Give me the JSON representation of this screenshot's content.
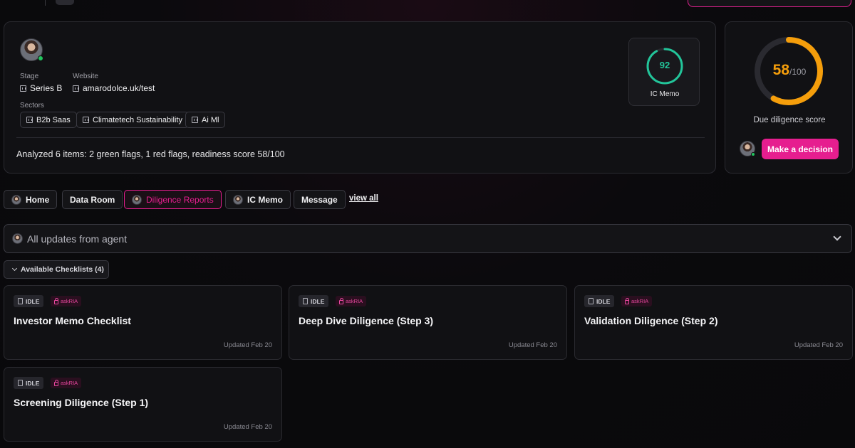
{
  "profile": {
    "stage_label": "Stage",
    "stage_value": "Series B",
    "website_label": "Website",
    "website_value": "amarodolce.uk/test",
    "sectors_label": "Sectors",
    "sectors": [
      "B2b Saas",
      "Climatetech Sustainability",
      "Ai Ml"
    ],
    "summary": "Analyzed 6 items: 2 green flags, 1 red flags, readiness score 58/100"
  },
  "ic_memo": {
    "score": "92",
    "score_fraction": 0.92,
    "label": "IC Memo",
    "color": "#22c59a"
  },
  "diligence": {
    "score": "58",
    "max": "/100",
    "score_fraction": 0.58,
    "label": "Due diligence score",
    "color": "#f59e0b"
  },
  "decision_button": {
    "label": "Make a decision",
    "color": "#e61e8f"
  },
  "tabs": [
    {
      "label": "Home",
      "has_avatar": true
    },
    {
      "label": "Data Room",
      "has_avatar": false
    },
    {
      "label": "Diligence Reports",
      "has_avatar": true,
      "active": true
    },
    {
      "label": "IC Memo",
      "has_avatar": true
    },
    {
      "label": "Message",
      "has_avatar": false
    }
  ],
  "view_all": "view all",
  "updates": {
    "label": "All updates from agent"
  },
  "checklists_toggle": "Available Checklists (4)",
  "checklists": [
    {
      "status": "IDLE",
      "tag": "askRIA",
      "title": "Investor Memo Checklist",
      "updated": "Updated Feb 20"
    },
    {
      "status": "IDLE",
      "tag": "askRIA",
      "title": "Deep Dive Diligence (Step 3)",
      "updated": "Updated Feb 20"
    },
    {
      "status": "IDLE",
      "tag": "askRIA",
      "title": "Validation Diligence (Step 2)",
      "updated": "Updated Feb 20"
    },
    {
      "status": "IDLE",
      "tag": "askRIA",
      "title": "Screening Diligence (Step 1)",
      "updated": "Updated Feb 20"
    }
  ]
}
